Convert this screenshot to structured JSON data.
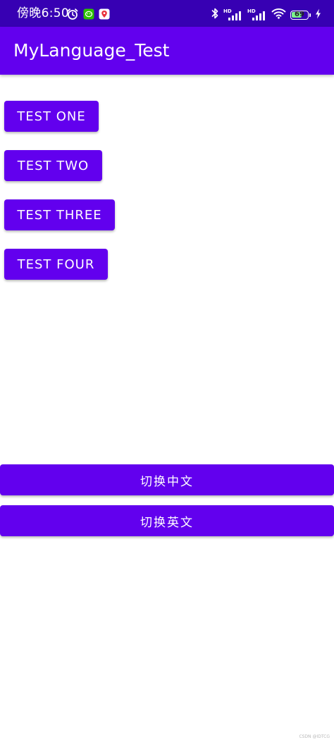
{
  "status_bar": {
    "time": "傍晚6:50",
    "battery_level": "69",
    "battery_fraction": 0.69,
    "signal_1_label": "HD",
    "signal_2_label": "HD",
    "icons": [
      "alarm-icon",
      "wechat-icon",
      "app-notification-icon",
      "bluetooth-icon",
      "signal-icon",
      "signal-icon",
      "wifi-icon",
      "battery-icon",
      "charging-icon"
    ]
  },
  "app_bar": {
    "title": "MyLanguage_Test"
  },
  "buttons": {
    "test_one": "TEST ONE",
    "test_two": "TEST TWO",
    "test_three": "TEST THREE",
    "test_four": "TEST FOUR",
    "switch_chinese": "切换中文",
    "switch_english": "切换英文"
  },
  "colors": {
    "status_bar": "#3700b3",
    "primary": "#6200ee",
    "background": "#ffffff",
    "battery_fill": "#7cf58b"
  },
  "watermark": "CSDN @IDTCG"
}
